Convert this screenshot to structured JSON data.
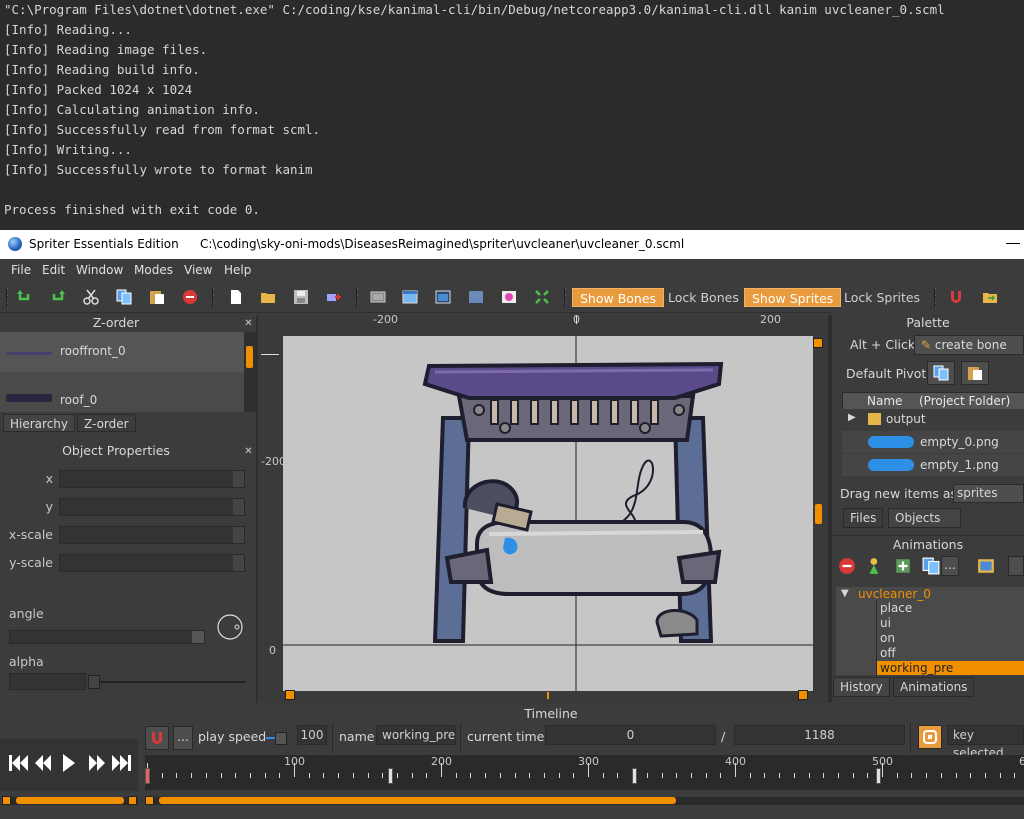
{
  "console": {
    "lines": [
      "\"C:\\Program Files\\dotnet\\dotnet.exe\" C:/coding/kse/kanimal-cli/bin/Debug/netcoreapp3.0/kanimal-cli.dll kanim uvcleaner_0.scml",
      "[Info] Reading...",
      "[Info] Reading image files.",
      "[Info] Reading build info.",
      "[Info] Packed 1024 x 1024",
      "[Info] Calculating animation info.",
      "[Info] Successfully read from format scml.",
      "[Info] Writing...",
      "[Info] Successfully wrote to format kanim",
      "",
      "Process finished with exit code 0."
    ]
  },
  "window": {
    "app_name": "Spriter Essentials Edition",
    "file_path": "C:\\coding\\sky-oni-mods\\DiseasesReimagined\\spriter\\uvcleaner\\uvcleaner_0.scml"
  },
  "menu": [
    "File",
    "Edit",
    "Window",
    "Modes",
    "View",
    "Help"
  ],
  "toolbar": {
    "show_bones": "Show Bones",
    "lock_bones": "Lock Bones",
    "show_sprites": "Show Sprites",
    "lock_sprites": "Lock Sprites"
  },
  "zorder_panel": {
    "title": "Z-order",
    "items": [
      "rooffront_0",
      "roof_0"
    ],
    "tabs": [
      "Hierarchy",
      "Z-order"
    ]
  },
  "object_properties": {
    "title": "Object Properties",
    "labels": {
      "x": "x",
      "y": "y",
      "x_scale": "x-scale",
      "y_scale": "y-scale",
      "angle": "angle",
      "alpha": "alpha"
    }
  },
  "canvas": {
    "ruler_h": [
      "-200",
      "0",
      "200"
    ],
    "ruler_v": [
      "-200",
      "0"
    ]
  },
  "palette": {
    "title": "Palette",
    "alt_click_label": "Alt + Click:",
    "create_bone": "create bone",
    "default_pivot": "Default Pivot:",
    "col_name": "Name",
    "col_folder": "(Project Folder)",
    "folder": "output",
    "files": [
      "empty_0.png",
      "empty_1.png"
    ],
    "drag_label": "Drag new items as",
    "drag_value": "sprites",
    "tabs": [
      "Files",
      "Objects"
    ]
  },
  "animations": {
    "title": "Animations",
    "entity": "uvcleaner_0",
    "items": [
      "place",
      "ui",
      "on",
      "off",
      "working_pre"
    ],
    "selected": "working_pre",
    "tabs": [
      "History",
      "Animations"
    ]
  },
  "timeline": {
    "title": "Timeline",
    "more": "...",
    "play_speed_label": "play speed",
    "play_speed": "100",
    "name_label": "name",
    "name_value": "working_pre",
    "current_time_label": "current time:",
    "current_time": "0",
    "slash": "/",
    "total_time": "1188",
    "key_selected": "key selected",
    "tick_labels": [
      "100",
      "200",
      "300",
      "400",
      "500",
      "6"
    ]
  },
  "colors": {
    "accent": "#f09000",
    "toggle_on": "#e89a3c",
    "console_bg": "#2b2b2b"
  }
}
